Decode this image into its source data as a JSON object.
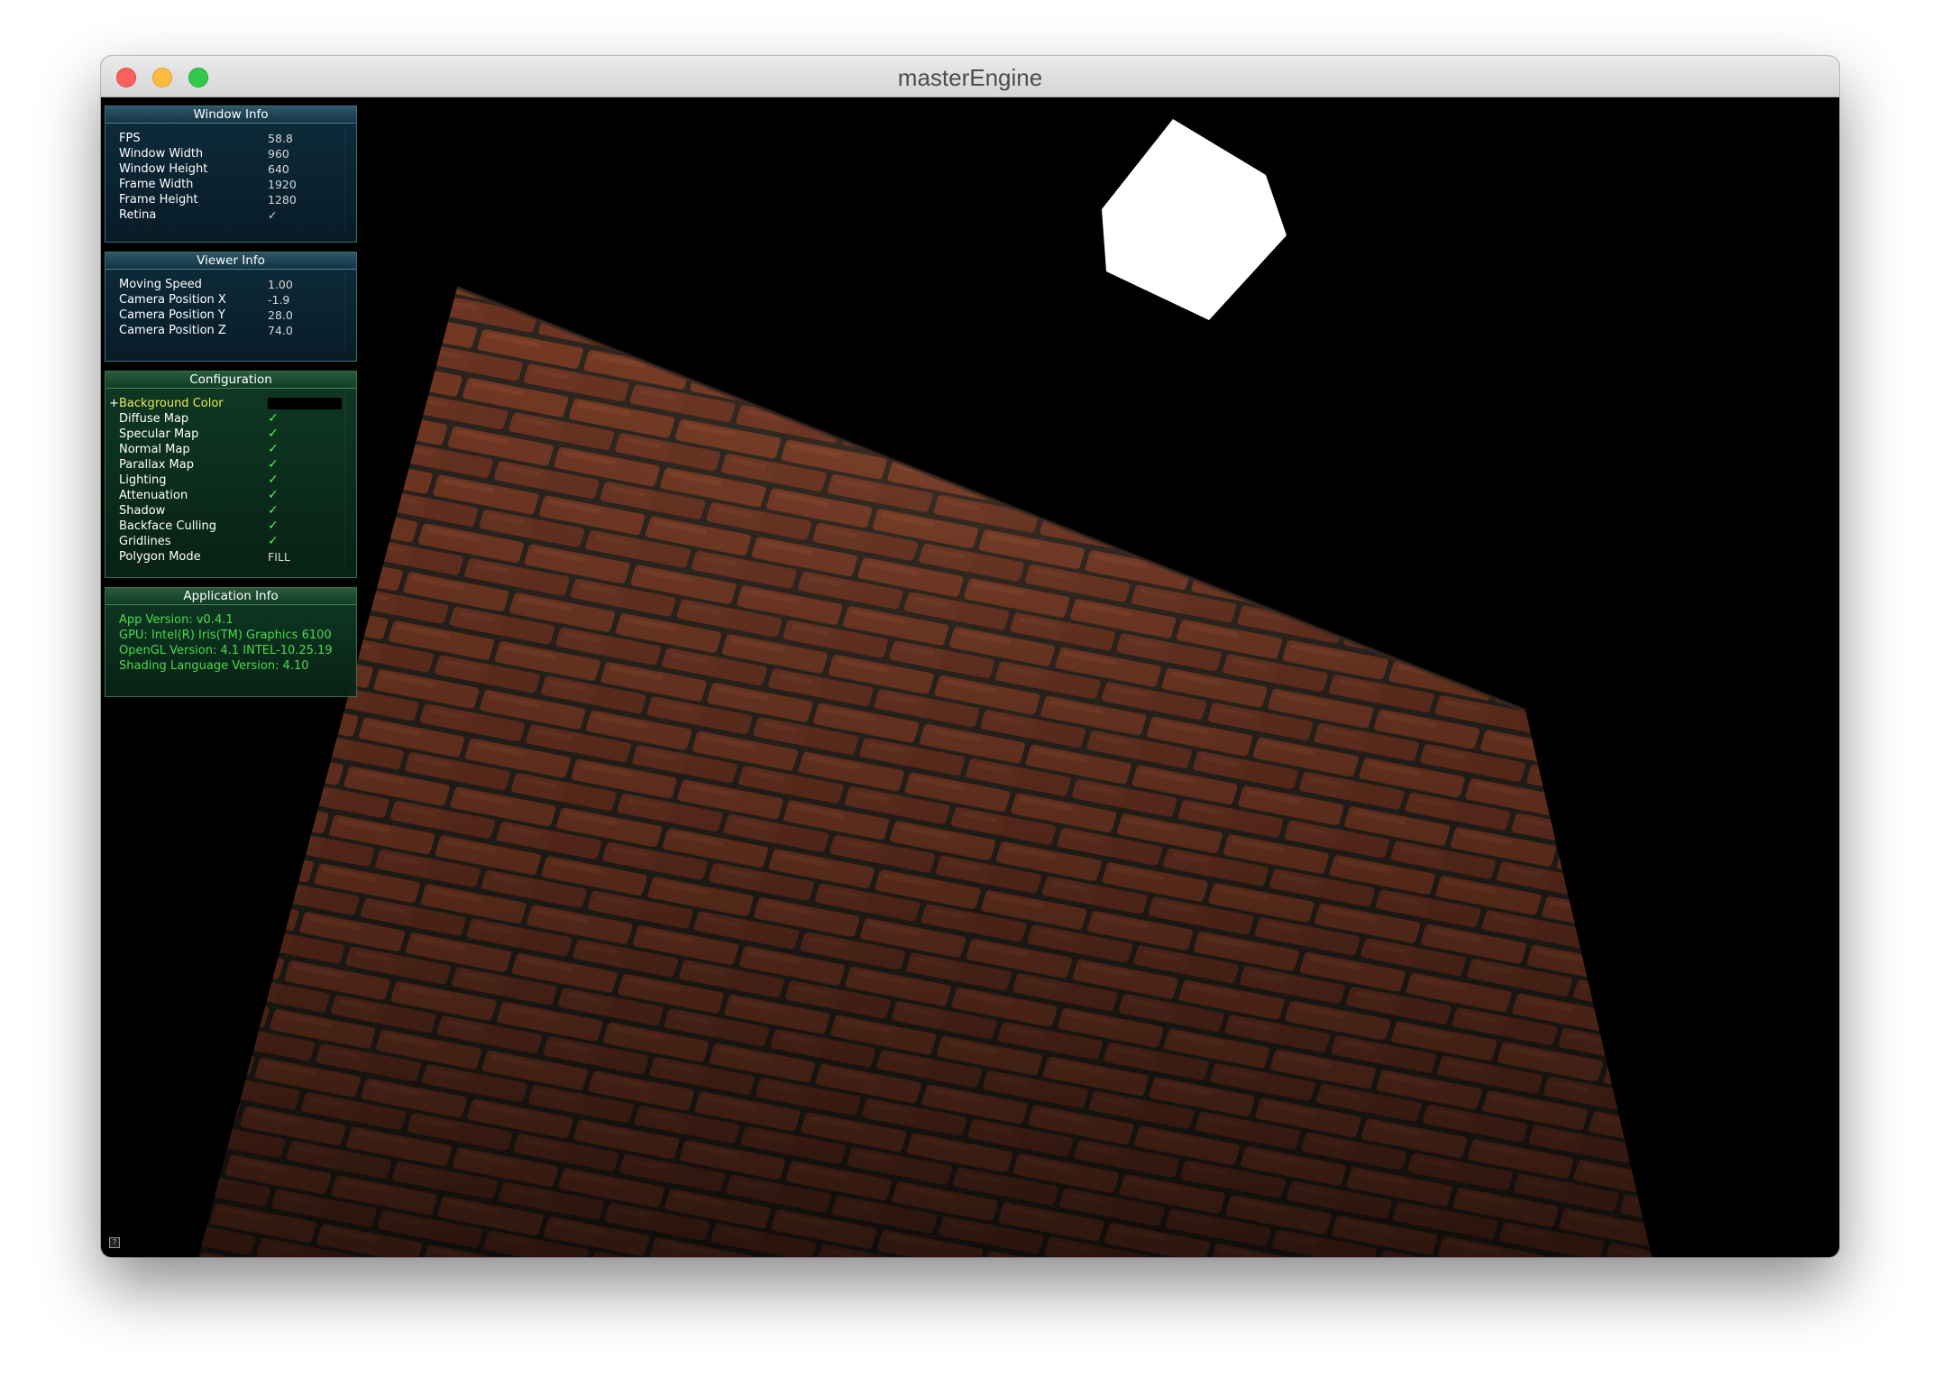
{
  "window": {
    "title": "masterEngine"
  },
  "panels": {
    "window_info": {
      "title": "Window Info",
      "rows": [
        {
          "label": "FPS",
          "value": "58.8"
        },
        {
          "label": "Window Width",
          "value": "960"
        },
        {
          "label": "Window Height",
          "value": "640"
        },
        {
          "label": "Frame Width",
          "value": "1920"
        },
        {
          "label": "Frame Height",
          "value": "1280"
        },
        {
          "label": "Retina",
          "value": "✓"
        }
      ]
    },
    "viewer_info": {
      "title": "Viewer Info",
      "rows": [
        {
          "label": "Moving Speed",
          "value": "1.00"
        },
        {
          "label": "Camera Position X",
          "value": "-1.9"
        },
        {
          "label": "Camera Position Y",
          "value": "28.0"
        },
        {
          "label": "Camera Position Z",
          "value": "74.0"
        }
      ]
    },
    "configuration": {
      "title": "Configuration",
      "background_color": {
        "label": "Background Color",
        "marker": "+",
        "color": "#000000"
      },
      "rows": [
        {
          "label": "Diffuse Map",
          "value": "✓"
        },
        {
          "label": "Specular Map",
          "value": "✓"
        },
        {
          "label": "Normal Map",
          "value": "✓"
        },
        {
          "label": "Parallax Map",
          "value": "✓"
        },
        {
          "label": "Lighting",
          "value": "✓"
        },
        {
          "label": "Attenuation",
          "value": "✓"
        },
        {
          "label": "Shadow",
          "value": "✓"
        },
        {
          "label": "Backface Culling",
          "value": "✓"
        },
        {
          "label": "Gridlines",
          "value": "✓"
        },
        {
          "label": "Polygon Mode",
          "value": "FILL"
        }
      ]
    },
    "application_info": {
      "title": "Application Info",
      "lines": [
        "App Version: v0.4.1",
        "GPU: Intel(R) Iris(TM) Graphics 6100",
        "OpenGL Version: 4.1 INTEL-10.25.19",
        "Shading Language Version: 4.10"
      ]
    }
  },
  "help": {
    "glyph": "?"
  },
  "colors": {
    "brick": "#7a3a24",
    "mortar": "#2a231e",
    "light_cube": "#ffffff",
    "check": "#55ee55",
    "app_info_text": "#4cd94c",
    "selected_label": "#e8e850"
  }
}
